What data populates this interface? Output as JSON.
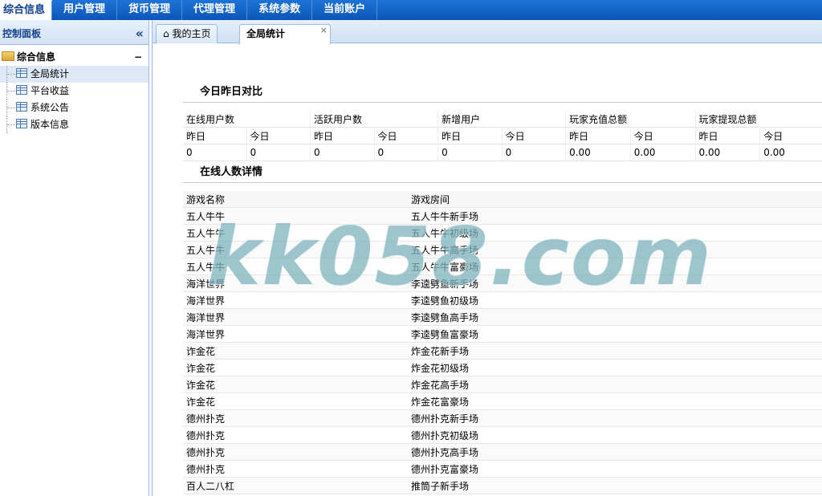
{
  "topnav": {
    "items": [
      "综合信息",
      "用户管理",
      "货币管理",
      "代理管理",
      "系统参数",
      "当前账户"
    ]
  },
  "sidebar": {
    "title": "控制面板",
    "collapse_icon": "«",
    "group": {
      "label": "综合信息",
      "toggle": "−"
    },
    "items": [
      {
        "label": "全局统计"
      },
      {
        "label": "平台收益"
      },
      {
        "label": "系统公告"
      },
      {
        "label": "版本信息"
      }
    ]
  },
  "tabs": [
    {
      "label": "我的主页",
      "icon": "home-icon"
    },
    {
      "label": "全局统计",
      "close": "×"
    }
  ],
  "comparison": {
    "title": "今日昨日对比",
    "groups": [
      "在线用户数",
      "活跃用户数",
      "新增用户",
      "玩家充值总额",
      "玩家提现总额"
    ],
    "sub_headers": [
      "昨日",
      "今日"
    ],
    "values": [
      "0",
      "0",
      "0",
      "0",
      "0",
      "0",
      "0.00",
      "0.00",
      "0.00",
      "0.00"
    ]
  },
  "online_detail": {
    "title": "在线人数详情",
    "columns": [
      "游戏名称",
      "游戏房间"
    ],
    "rows": [
      [
        "五人牛牛",
        "五人牛牛新手场"
      ],
      [
        "五人牛牛",
        "五人牛牛初级场"
      ],
      [
        "五人牛牛",
        "五人牛牛高手场"
      ],
      [
        "五人牛牛",
        "五人牛牛富豪场"
      ],
      [
        "海洋世界",
        "李逵劈鱼新手场"
      ],
      [
        "海洋世界",
        "李逵劈鱼初级场"
      ],
      [
        "海洋世界",
        "李逵劈鱼高手场"
      ],
      [
        "海洋世界",
        "李逵劈鱼富豪场"
      ],
      [
        "诈金花",
        "炸金花新手场"
      ],
      [
        "诈金花",
        "炸金花初级场"
      ],
      [
        "诈金花",
        "炸金花高手场"
      ],
      [
        "诈金花",
        "炸金花富豪场"
      ],
      [
        "德州扑克",
        "德州扑克新手场"
      ],
      [
        "德州扑克",
        "德州扑克初级场"
      ],
      [
        "德州扑克",
        "德州扑克高手场"
      ],
      [
        "德州扑克",
        "德州扑克富豪场"
      ],
      [
        "百人二八杠",
        "推筒子新手场"
      ]
    ]
  },
  "watermark": "kk058.com"
}
